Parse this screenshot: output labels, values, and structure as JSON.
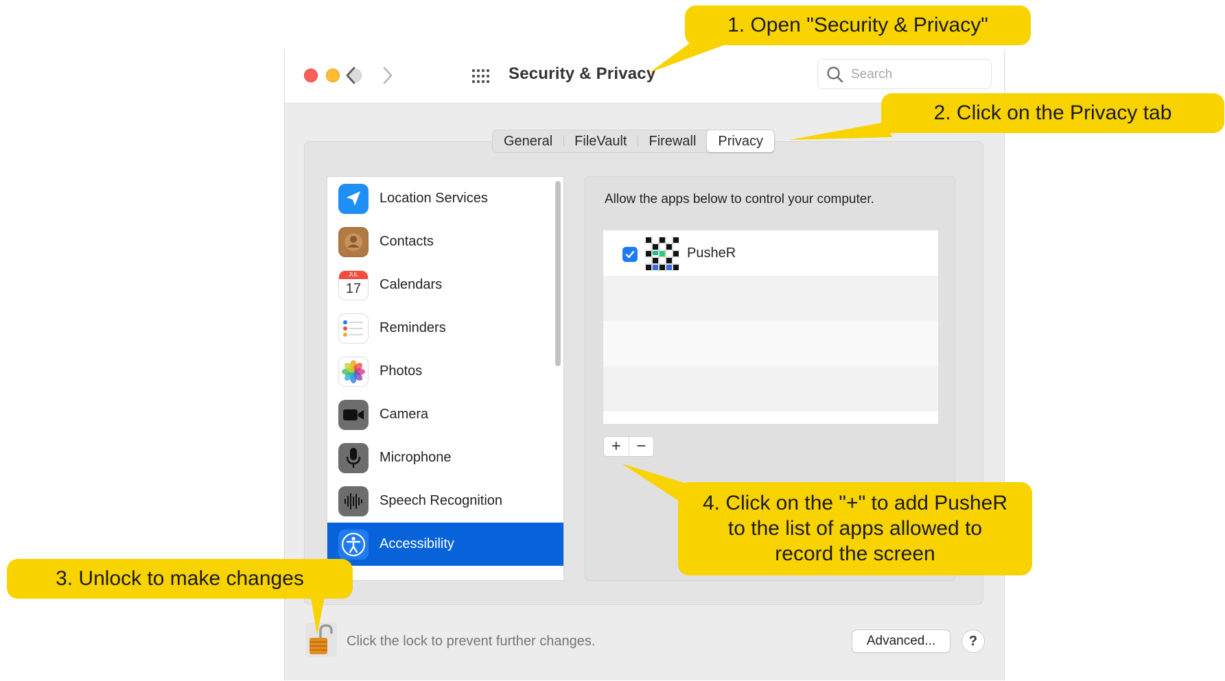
{
  "window": {
    "title": "Security & Privacy",
    "search_placeholder": "Search"
  },
  "tabs": [
    {
      "label": "General",
      "active": false
    },
    {
      "label": "FileVault",
      "active": false
    },
    {
      "label": "Firewall",
      "active": false
    },
    {
      "label": "Privacy",
      "active": true
    }
  ],
  "sidebar": {
    "items": [
      {
        "label": "Location Services",
        "icon": "location-icon"
      },
      {
        "label": "Contacts",
        "icon": "contacts-icon"
      },
      {
        "label": "Calendars",
        "icon": "calendar-icon",
        "icon_month": "JUL",
        "icon_day": "17"
      },
      {
        "label": "Reminders",
        "icon": "reminders-icon"
      },
      {
        "label": "Photos",
        "icon": "photos-icon"
      },
      {
        "label": "Camera",
        "icon": "camera-icon"
      },
      {
        "label": "Microphone",
        "icon": "microphone-icon"
      },
      {
        "label": "Speech Recognition",
        "icon": "speech-recognition-icon"
      },
      {
        "label": "Accessibility",
        "icon": "accessibility-icon",
        "selected": true
      }
    ]
  },
  "main": {
    "description": "Allow the apps below to control your computer.",
    "apps": [
      {
        "name": "PusheR",
        "checked": true,
        "icon": "pusher-app-icon"
      }
    ],
    "add_label": "+",
    "remove_label": "−"
  },
  "footer": {
    "lock_text": "Click the lock to prevent further changes.",
    "advanced_label": "Advanced...",
    "help_label": "?"
  },
  "callouts": {
    "step1": "1. Open \"Security & Privacy\"",
    "step2": "2. Click on the Privacy tab",
    "step3": "3. Unlock to make changes",
    "step4_line1": "4. Click on the \"+\" to add PusheR",
    "step4_line2": "to the list of apps allowed to",
    "step4_line3": "record the screen"
  },
  "colors": {
    "callout": "#f8d300",
    "selection": "#0863da",
    "checkbox": "#1d7bf5"
  }
}
